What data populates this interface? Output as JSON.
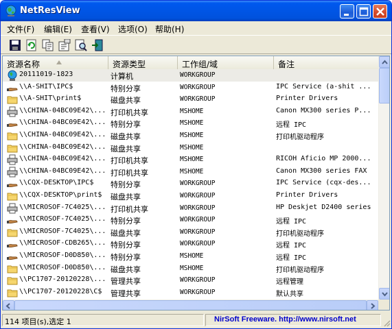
{
  "window": {
    "title": "NetResView"
  },
  "menu": [
    {
      "label": "文件(F)"
    },
    {
      "label": "编辑(E)"
    },
    {
      "label": "查看(V)"
    },
    {
      "label": "选项(O)"
    },
    {
      "label": "帮助(H)"
    }
  ],
  "toolbar": {
    "buttons": [
      {
        "icon": "save-icon"
      },
      {
        "icon": "refresh-icon"
      },
      {
        "icon": "copy-icon"
      },
      {
        "icon": "properties-icon"
      },
      {
        "icon": "find-icon"
      },
      {
        "icon": "exit-icon"
      }
    ]
  },
  "columns": [
    {
      "label": "资源名称"
    },
    {
      "label": "资源类型"
    },
    {
      "label": "工作组/域"
    },
    {
      "label": "备注"
    }
  ],
  "rows": [
    {
      "icon": "computer-icon",
      "name": "20111019-1823",
      "type": "计算机",
      "workgroup": "WORKGROUP",
      "remark": ""
    },
    {
      "icon": "share-hand-icon",
      "name": "\\\\A-SHIT\\IPC$",
      "type": "特别分享",
      "workgroup": "WORKGROUP",
      "remark": "IPC Service (a-shit ..."
    },
    {
      "icon": "folder-icon",
      "name": "\\\\A-SHIT\\print$",
      "type": "磁盘共享",
      "workgroup": "WORKGROUP",
      "remark": "Printer Drivers"
    },
    {
      "icon": "printer-icon",
      "name": "\\\\CHINA-04BC09E42\\...",
      "type": "打印机共享",
      "workgroup": "MSHOME",
      "remark": "Canon MX300 series P..."
    },
    {
      "icon": "share-hand-icon",
      "name": "\\\\CHINA-04BC09E42\\...",
      "type": "特别分享",
      "workgroup": "MSHOME",
      "remark": "远程 IPC"
    },
    {
      "icon": "folder-icon",
      "name": "\\\\CHINA-04BC09E42\\...",
      "type": "磁盘共享",
      "workgroup": "MSHOME",
      "remark": "打印机驱动程序"
    },
    {
      "icon": "folder-icon",
      "name": "\\\\CHINA-04BC09E42\\...",
      "type": "磁盘共享",
      "workgroup": "MSHOME",
      "remark": ""
    },
    {
      "icon": "printer-icon",
      "name": "\\\\CHINA-04BC09E42\\...",
      "type": "打印机共享",
      "workgroup": "MSHOME",
      "remark": "RICOH Aficio MP 2000..."
    },
    {
      "icon": "printer-icon",
      "name": "\\\\CHINA-04BC09E42\\...",
      "type": "打印机共享",
      "workgroup": "MSHOME",
      "remark": "Canon MX300 series FAX"
    },
    {
      "icon": "share-hand-icon",
      "name": "\\\\CQX-DESKTOP\\IPC$",
      "type": "特别分享",
      "workgroup": "WORKGROUP",
      "remark": "IPC Service (cqx-des..."
    },
    {
      "icon": "folder-icon",
      "name": "\\\\CQX-DESKTOP\\print$",
      "type": "磁盘共享",
      "workgroup": "WORKGROUP",
      "remark": "Printer Drivers"
    },
    {
      "icon": "printer-icon",
      "name": "\\\\MICROSOF-7C4025\\...",
      "type": "打印机共享",
      "workgroup": "WORKGROUP",
      "remark": "HP Deskjet D2400 series"
    },
    {
      "icon": "share-hand-icon",
      "name": "\\\\MICROSOF-7C4025\\...",
      "type": "特别分享",
      "workgroup": "WORKGROUP",
      "remark": "远程 IPC"
    },
    {
      "icon": "folder-icon",
      "name": "\\\\MICROSOF-7C4025\\...",
      "type": "磁盘共享",
      "workgroup": "WORKGROUP",
      "remark": "打印机驱动程序"
    },
    {
      "icon": "share-hand-icon",
      "name": "\\\\MICROSOF-CDB265\\...",
      "type": "特别分享",
      "workgroup": "WORKGROUP",
      "remark": "远程 IPC"
    },
    {
      "icon": "share-hand-icon",
      "name": "\\\\MICROSOF-D0D850\\...",
      "type": "特别分享",
      "workgroup": "MSHOME",
      "remark": "远程 IPC"
    },
    {
      "icon": "folder-icon",
      "name": "\\\\MICROSOF-D0D850\\...",
      "type": "磁盘共享",
      "workgroup": "MSHOME",
      "remark": "打印机驱动程序"
    },
    {
      "icon": "folder-icon",
      "name": "\\\\PC1707-20120228\\...",
      "type": "管理共享",
      "workgroup": "WORKGROUP",
      "remark": "远程管理"
    },
    {
      "icon": "folder-icon",
      "name": "\\\\PC1707-20120228\\C$",
      "type": "管理共享",
      "workgroup": "WORKGROUP",
      "remark": "默认共享"
    },
    {
      "icon": "folder-icon",
      "name": "\\\\PC1707-20120228\\D$",
      "type": "管理共享",
      "workgroup": "WORKGROUP",
      "remark": "默认共享"
    }
  ],
  "status": {
    "count": "114 项目(s),选定 1",
    "credit": "NirSoft Freeware.  http://www.nirsoft.net"
  }
}
